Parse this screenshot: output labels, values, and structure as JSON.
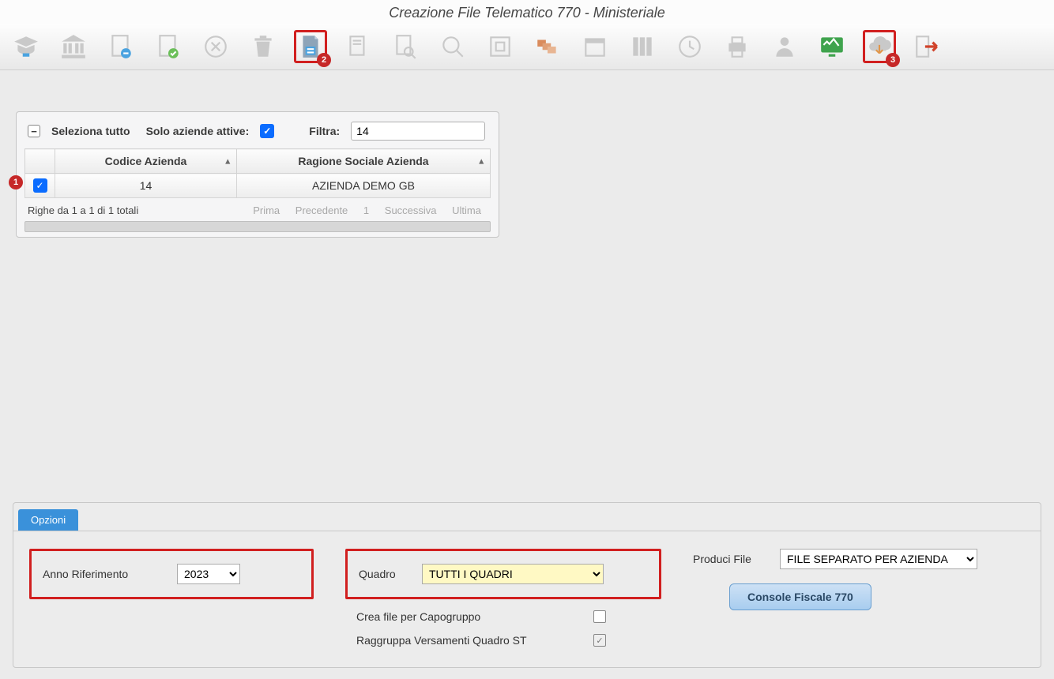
{
  "title": "Creazione File Telematico 770 - Ministeriale",
  "toolbar_badges": {
    "file": "2",
    "cloud": "3"
  },
  "filter_panel": {
    "select_all": "Seleziona tutto",
    "only_active": "Solo aziende attive:",
    "filter_label": "Filtra:",
    "filter_value": "14"
  },
  "grid": {
    "col_check": "",
    "col_code": "Codice Azienda",
    "col_name": "Ragione Sociale Azienda",
    "row": {
      "code": "14",
      "name": "AZIENDA DEMO GB"
    },
    "row_badge": "1"
  },
  "pager": {
    "info": "Righe da 1 a 1 di 1 totali",
    "first": "Prima",
    "prev": "Precedente",
    "page": "1",
    "next": "Successiva",
    "last": "Ultima"
  },
  "tab": "Opzioni",
  "options": {
    "anno_label": "Anno Riferimento",
    "anno_value": "2023",
    "quadro_label": "Quadro",
    "quadro_value": "TUTTI I QUADRI",
    "capogruppo_label": "Crea file per Capogruppo",
    "raggruppa_label": "Raggruppa Versamenti Quadro ST",
    "produci_label": "Produci File",
    "produci_value": "FILE SEPARATO PER AZIENDA",
    "console_btn": "Console Fiscale 770"
  }
}
